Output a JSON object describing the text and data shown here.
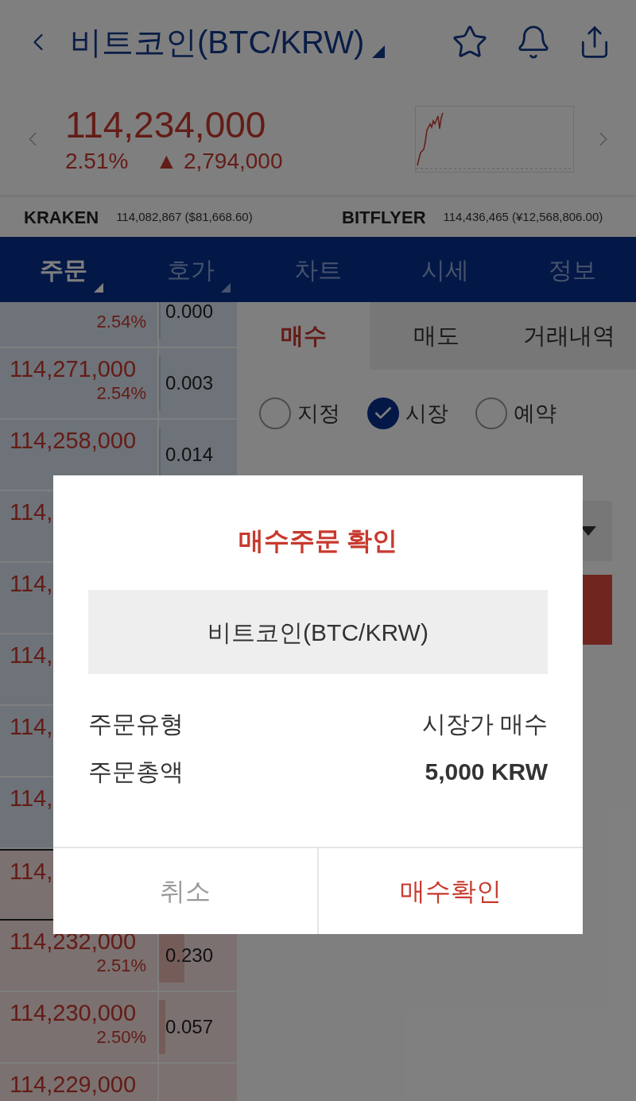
{
  "header": {
    "title": "비트코인(BTC/KRW)"
  },
  "ticker": {
    "price": "114,234,000",
    "change_pct": "2.51%",
    "change": "▲ 2,794,000"
  },
  "exchanges": [
    {
      "name": "KRAKEN",
      "value": "114,082,867 ($81,668.60)"
    },
    {
      "name": "BITFLYER",
      "value": "114,436,465 (¥12,568,806.00)"
    }
  ],
  "tabs": [
    {
      "label": "주문",
      "selected": true,
      "dropdown": true
    },
    {
      "label": "호가",
      "selected": false,
      "dropdown": true
    },
    {
      "label": "차트",
      "selected": false,
      "dropdown": false
    },
    {
      "label": "시세",
      "selected": false,
      "dropdown": false
    },
    {
      "label": "정보",
      "selected": false,
      "dropdown": false
    }
  ],
  "order_book": [
    {
      "kind": "ask",
      "current": false,
      "pct": "2.54%",
      "qty": "0.000",
      "level": 0
    },
    {
      "kind": "ask",
      "current": false,
      "price": "114,271,000",
      "pct": "2.54%",
      "qty": "0.003",
      "level": 0
    },
    {
      "kind": "ask",
      "current": false,
      "price": "114,258,000",
      "qty": "0.014",
      "level": 0.02
    },
    {
      "kind": "ask",
      "current": false,
      "price": "114,"
    },
    {
      "kind": "ask",
      "current": false,
      "price": "114,"
    },
    {
      "kind": "ask",
      "current": false,
      "price": "114,"
    },
    {
      "kind": "ask",
      "current": false,
      "price": "114,"
    },
    {
      "kind": "ask",
      "current": false,
      "price": "114,"
    },
    {
      "kind": "bid",
      "current": true,
      "price": "114,"
    },
    {
      "kind": "bid",
      "current": false,
      "price": "114,232,000",
      "pct": "2.51%",
      "qty": "0.230",
      "level": 0.33
    },
    {
      "kind": "bid",
      "current": false,
      "price": "114,230,000",
      "pct": "2.50%",
      "qty": "0.057",
      "level": 0.08
    },
    {
      "kind": "bid",
      "current": false,
      "price": "114,229,000"
    }
  ],
  "order_tabs": [
    {
      "label": "매수",
      "selected": true
    },
    {
      "label": "매도",
      "selected": false
    },
    {
      "label": "거래내역",
      "selected": false
    }
  ],
  "order_types": [
    {
      "label": "지정",
      "checked": false
    },
    {
      "label": "시장",
      "checked": true
    },
    {
      "label": "예약",
      "checked": false
    }
  ],
  "dialog": {
    "title": "매수주문 확인",
    "asset": "비트코인(BTC/KRW)",
    "rows": [
      {
        "label": "주문유형",
        "value": "시장가 매수",
        "bold": false
      },
      {
        "label": "주문총액",
        "value": "5,000 KRW",
        "bold": true
      }
    ],
    "buttons": [
      {
        "label": "취소",
        "kind": "cancel"
      },
      {
        "label": "매수확인",
        "kind": "confirm"
      }
    ]
  }
}
